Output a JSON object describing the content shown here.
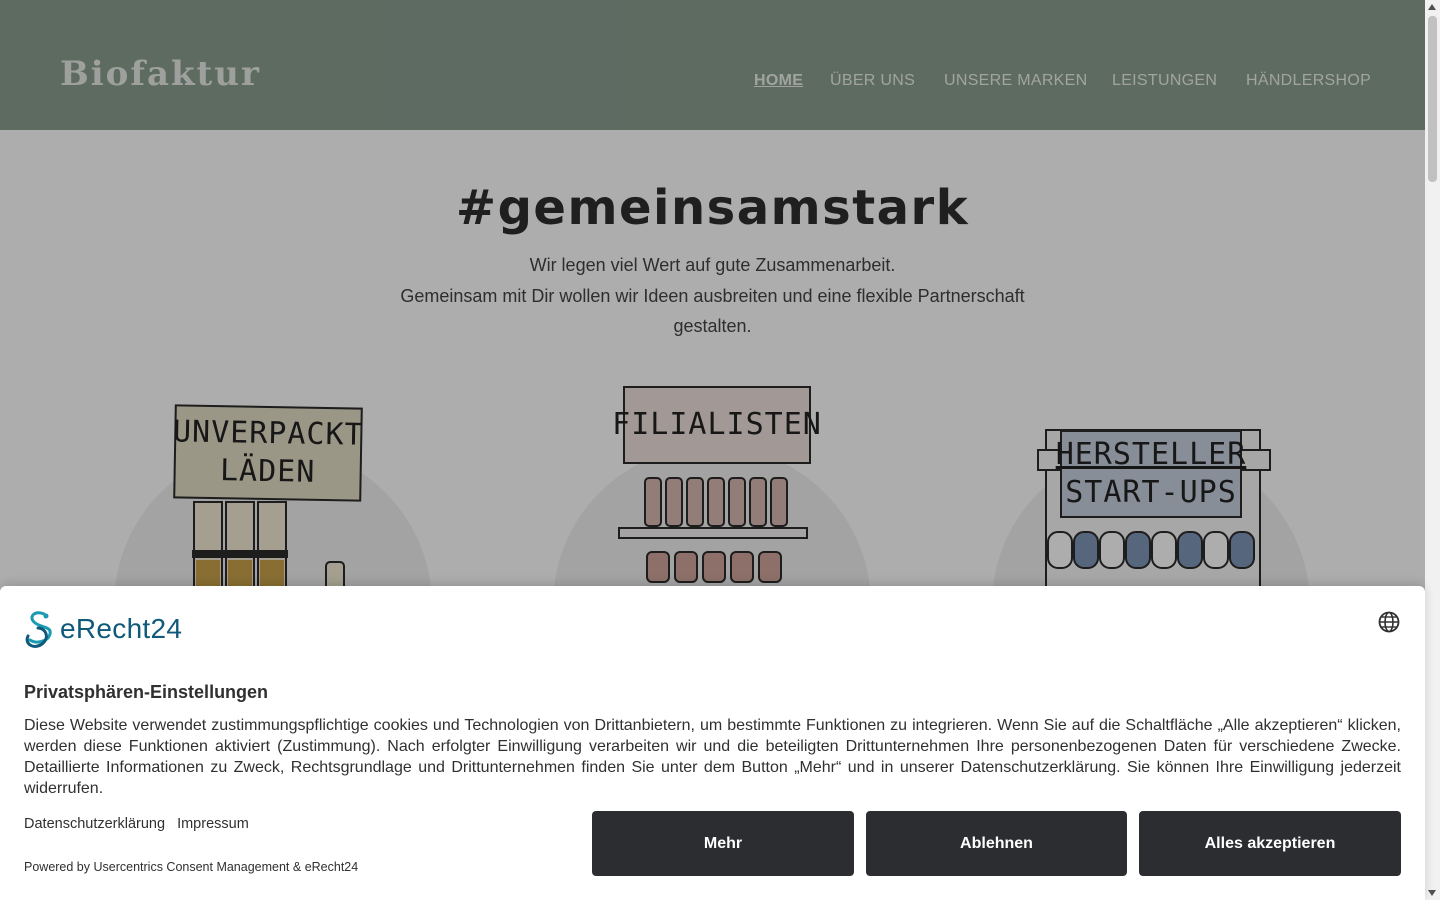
{
  "header": {
    "logo": "Biofaktur",
    "nav": [
      "HOME",
      "ÜBER UNS",
      "UNSERE MARKEN",
      "LEISTUNGEN",
      "HÄNDLERSHOP"
    ],
    "active_nav": "HOME"
  },
  "hero": {
    "title": "#gemeinsamstark",
    "line1": "Wir legen viel Wert auf gute Zusammenarbeit.",
    "line2": "Gemeinsam mit Dir wollen wir Ideen ausbreiten und eine flexible Partnerschaft",
    "line3": "gestalten."
  },
  "cards": [
    {
      "sign_line1": "UNVERPACKT",
      "sign_line2": "LÄDEN"
    },
    {
      "sign_line1": "FILIALISTEN",
      "sign_line2": ""
    },
    {
      "sign_line1": "HERSTELLER",
      "sign_line2": "START-UPS"
    }
  ],
  "consent": {
    "brand": "eRecht24",
    "title": "Privatsphären-Einstellungen",
    "text": "Diese Website verwendet zustimmungspflichtige cookies und Technologien von Drittanbietern, um bestimmte Funktionen zu integrieren. Wenn Sie auf die Schaltfläche „Alle akzeptieren“ klicken, werden diese Funktionen aktiviert (Zustimmung). Nach erfolgter Einwilligung verarbeiten wir und die beteiligten Drittunternehmen Ihre personenbezogenen Daten für verschiedene Zwecke. Detaillierte Informationen zu Zweck, Rechtsgrundlage und Drittunternehmen finden Sie unter dem Button „Mehr“ und in unserer Datenschutzerklärung. Sie können Ihre Einwilligung jederzeit widerrufen.",
    "link_privacy": "Datenschutzerklärung",
    "link_imprint": "Impressum",
    "powered": "Powered by Usercentrics Consent Management & eRecht24",
    "btn_more": "Mehr",
    "btn_deny": "Ablehnen",
    "btn_accept": "Alles akzeptieren"
  },
  "colors": {
    "header_bg": "#8a9e90",
    "button_bg": "#2b2d30",
    "brand_blue": "#0f5a7a",
    "brand_teal": "#1a9ab0"
  },
  "icons": [
    "globe-icon",
    "erecht24-logo-icon"
  ]
}
